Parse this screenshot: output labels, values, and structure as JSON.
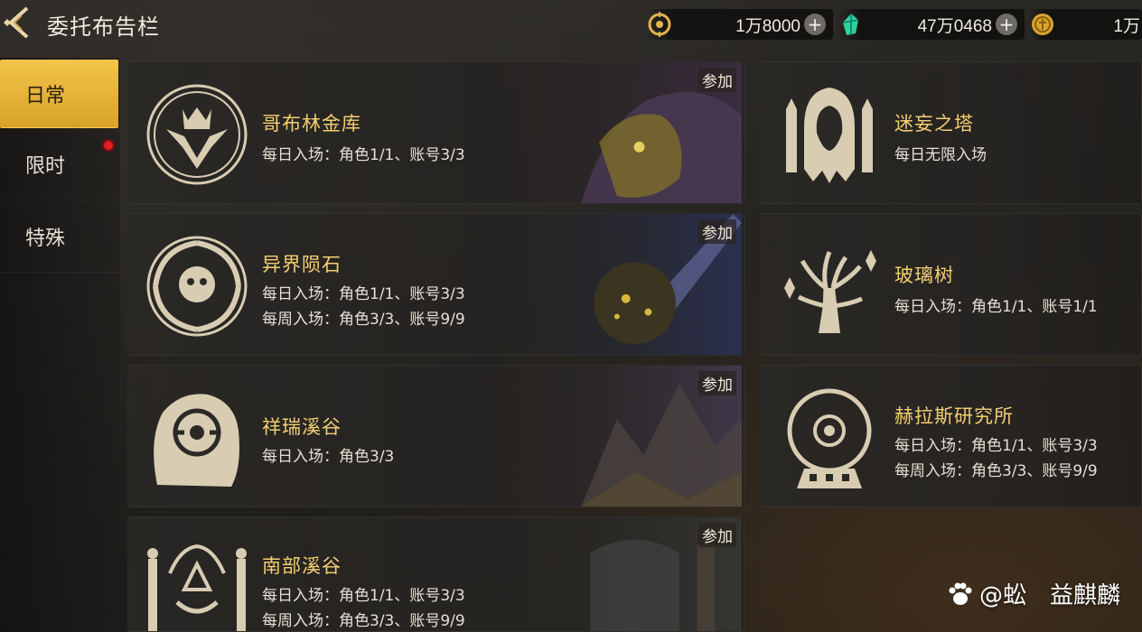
{
  "header": {
    "title": "委托布告栏"
  },
  "currencies": [
    {
      "icon": "gold-coin-c-icon",
      "value": "1万8000"
    },
    {
      "icon": "green-crystal-icon",
      "value": "47万0468"
    },
    {
      "icon": "gold-medal-icon",
      "value": "1万"
    }
  ],
  "sidebar": {
    "tabs": [
      {
        "label": "日常",
        "active": true
      },
      {
        "label": "限时",
        "badge": true
      },
      {
        "label": "特殊"
      }
    ]
  },
  "join_label": "参加",
  "cards": [
    {
      "name": "哥布林金库",
      "lines": [
        "每日入场：角色1/1、账号3/3"
      ],
      "emblem": "goblin-crown-icon",
      "join": true
    },
    {
      "name": "迷妄之塔",
      "lines": [
        "每日无限入场"
      ],
      "emblem": "hooded-tower-icon",
      "join": false
    },
    {
      "name": "异界陨石",
      "lines": [
        "每日入场：角色1/1、账号3/3",
        "每周入场：角色3/3、账号9/9"
      ],
      "emblem": "vortex-meteor-icon",
      "join": true
    },
    {
      "name": "玻璃树",
      "lines": [
        "每日入场：角色1/1、账号1/1"
      ],
      "emblem": "crystal-tree-icon",
      "join": false
    },
    {
      "name": "祥瑞溪谷",
      "lines": [
        "每日入场：角色3/3"
      ],
      "emblem": "rune-stone-icon",
      "join": true
    },
    {
      "name": "赫拉斯研究所",
      "lines": [
        "每日入场：角色1/1、账号3/3",
        "每周入场：角色3/3、账号9/9"
      ],
      "emblem": "orb-lab-icon",
      "join": false
    },
    {
      "name": "南部溪谷",
      "lines": [
        "每日入场：角色1/1、账号3/3",
        "每周入场：角色3/3、账号9/9"
      ],
      "emblem": "sun-pillars-icon",
      "join": true
    }
  ],
  "watermark": {
    "text": "@蚣　益麒麟"
  }
}
